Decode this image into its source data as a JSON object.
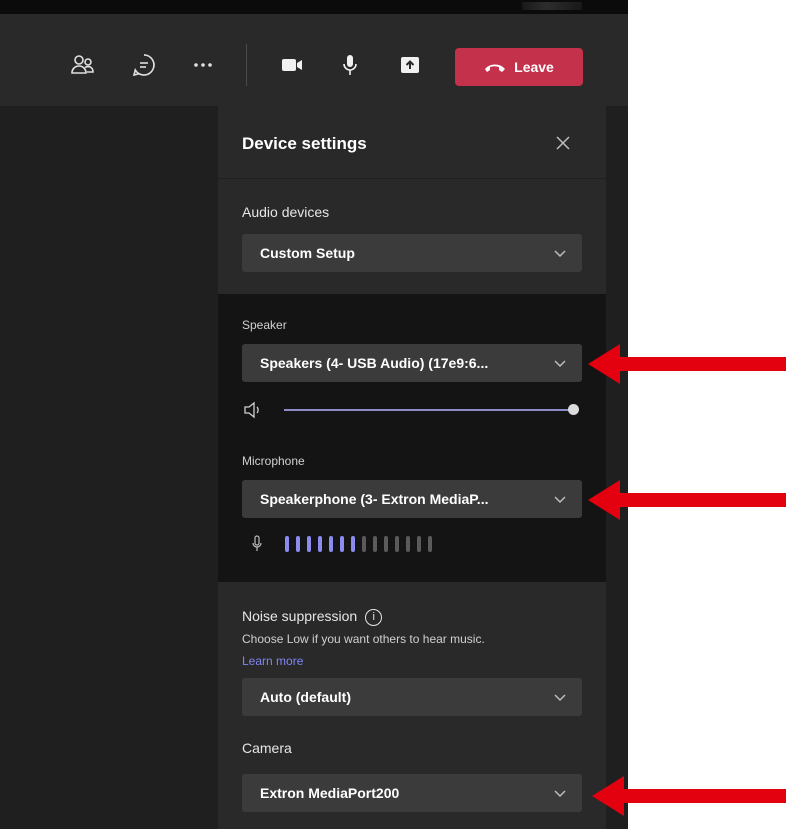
{
  "toolbar": {
    "icons": [
      "people-icon",
      "chat-icon",
      "more-icon",
      "camera-icon",
      "mic-icon",
      "share-icon"
    ],
    "leave_label": "Leave",
    "leave_color": "#c4314b"
  },
  "panel": {
    "title": "Device settings",
    "audio_devices_label": "Audio devices",
    "audio_devices_value": "Custom Setup",
    "speaker_label": "Speaker",
    "speaker_value": "Speakers (4- USB Audio) (17e9:6...",
    "speaker_volume": 1.0,
    "microphone_label": "Microphone",
    "microphone_value": "Speakerphone (3- Extron MediaP...",
    "mic_level": {
      "active": 7,
      "total": 14
    },
    "noise_label": "Noise suppression",
    "noise_info_glyph": "i",
    "noise_hint": "Choose Low if you want others to hear music.",
    "learn_more": "Learn more",
    "noise_value": "Auto (default)",
    "camera_label": "Camera",
    "camera_value": "Extron MediaPort200"
  },
  "colors": {
    "accent": "#7f85f5",
    "meter_active": "#8b8cf0",
    "meter_inactive": "#5a5a5a",
    "annotation_arrow": "#e3000f"
  }
}
